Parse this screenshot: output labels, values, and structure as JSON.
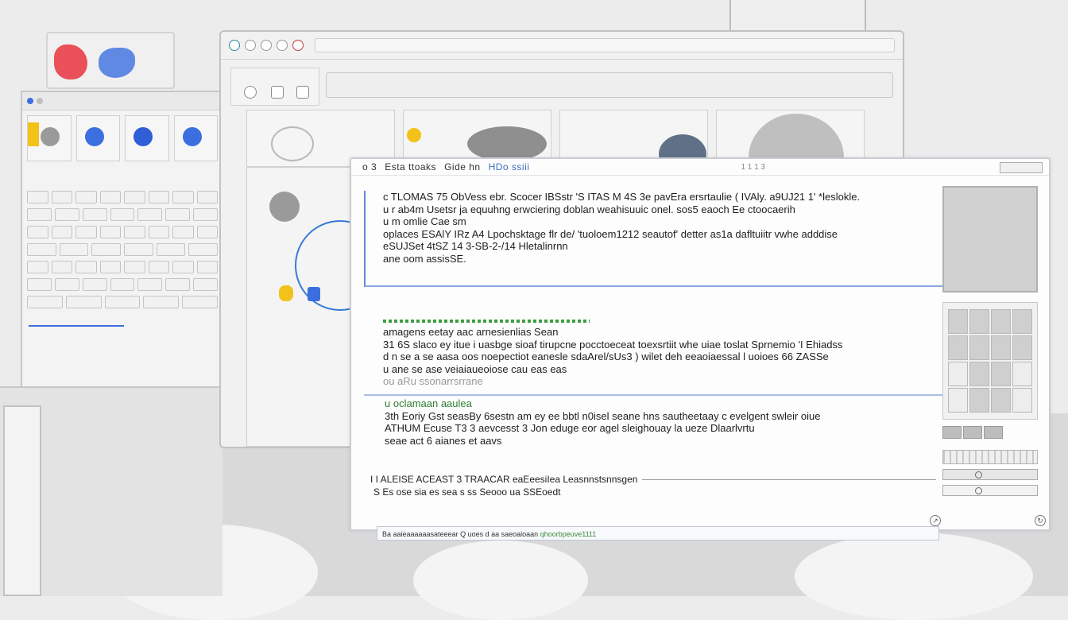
{
  "colors": {
    "accent_blue": "#3b6fe0",
    "accent_red": "#e9343e",
    "accent_green": "#3e9c40",
    "accent_yellow": "#f3c21a"
  },
  "front": {
    "menu_items": [
      "o 3",
      "Esta ttoaks",
      "Gide hn",
      "HDo ssiii"
    ],
    "header_mid": "1 1 1 3",
    "block1": [
      "c TLOMAS 75 ObVess ebr. Scocer IBSstr 'S ITAS M 4S 3e pavEra ersrtaulie ( IVAly. a9UJ21 1' *leslokle.",
      "u r ab4m Usetsr ja equuhng erwciering doblan weahisuuic onel. sos5 eaoch Ee ctoocaerih",
      "u m omlie Cae sm",
      "oplaces ESAlY IRz A4 Lpochsktage flr de/ 'tuoloem1212 seautof' detter as1a dafltuiitr vwhe adddise",
      "eSUJSet 4tSZ 14 3-SB-2-/14 Hletalinrnn",
      "ane oom assisSE."
    ],
    "block2": [
      "amagens eetay aac arnesienlias Sean",
      "31 6S slaco ey itue i uasbge sioaf tirupcne pocctoeceat toexsrtiit whe uiae toslat Sprnemio 'I Ehiadss",
      "d n se a se aasa oos noepectiot eanesle sdaArel/sUs3 ) wilet deh eeaoiaessal l uoioes 66 ZASSe",
      "u ane se ase veiaiaueoiose cau eas eas",
      "ou aRu ssonarrsrrane"
    ],
    "block3": [
      "u oclamaan aaulea",
      "3th Eoriy Gst seasBy 6sestn am ey ee bbtl n0isel seane hns sautheetaay c evelgent swleir oiue",
      "ATHUM Ecuse T3 3 aevcesst 3 Jon eduge eor agel sleighouay la ueze Dlaarlvrtu",
      "seae act 6 aianes et aavs"
    ],
    "section_title": "I I ALEISE ACEAST 3 TRAACAR eaEeesiIea Leasnnstsnnsgen",
    "section_sub": "S Es ose sia es sea s ss Seooo ua SSEoedt",
    "status_text": "Ba aaieaaaaaasateeear Q uoes d aa saeoaioaan",
    "status_hl": "qhoorbpeuve1111"
  }
}
